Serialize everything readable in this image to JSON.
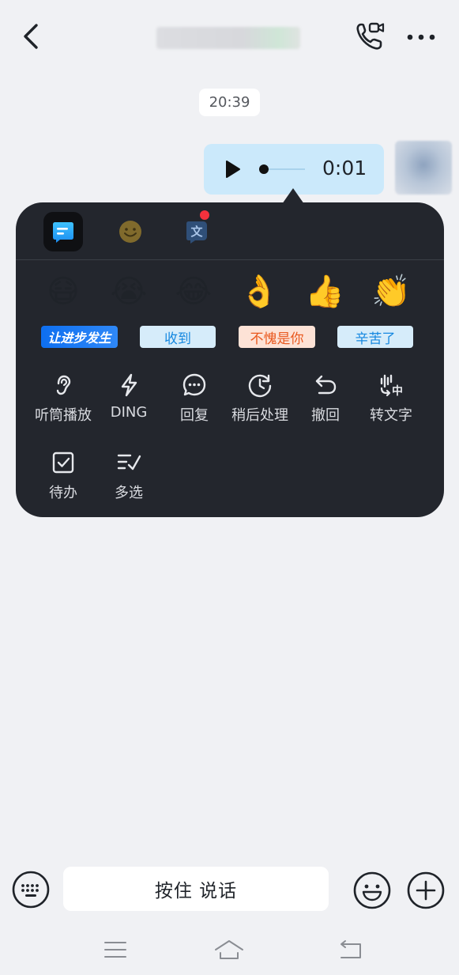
{
  "header": {
    "title_blurred": true,
    "icons": {
      "back": "chevron-left-icon",
      "call": "video-call-icon",
      "more": "more-dots-icon"
    }
  },
  "chat": {
    "timestamp": "20:39",
    "voice_message": {
      "duration": "0:01",
      "progress": 0.0
    }
  },
  "popup": {
    "tabs": [
      {
        "name": "quick-actions",
        "icon": "message-card-icon",
        "active": true
      },
      {
        "name": "emoji",
        "icon": "smiley-icon",
        "active": false
      },
      {
        "name": "translate",
        "icon": "translate-icon",
        "active": false,
        "has_badge": true
      }
    ],
    "emojis": [
      "😷",
      "😭",
      "😂",
      "👌",
      "👍",
      "👏"
    ],
    "stickers": [
      "让进步发生",
      "收到",
      "不愧是你",
      "辛苦了"
    ],
    "actions": [
      {
        "label": "听筒播放",
        "icon": "ear-icon"
      },
      {
        "label": "DING",
        "icon": "lightning-icon"
      },
      {
        "label": "回复",
        "icon": "reply-bubble-icon"
      },
      {
        "label": "稍后处理",
        "icon": "clock-later-icon"
      },
      {
        "label": "撤回",
        "icon": "undo-icon"
      },
      {
        "label": "转文字",
        "icon": "voice-to-text-icon"
      },
      {
        "label": "待办",
        "icon": "todo-check-icon"
      },
      {
        "label": "多选",
        "icon": "multi-select-icon"
      }
    ]
  },
  "input_bar": {
    "talk_label": "按住 说话"
  },
  "colors": {
    "popup_bg": "#23262d",
    "bubble_bg": "#cbe9fb",
    "badge_red": "#f5313d",
    "accent_blue": "#1688e0"
  }
}
